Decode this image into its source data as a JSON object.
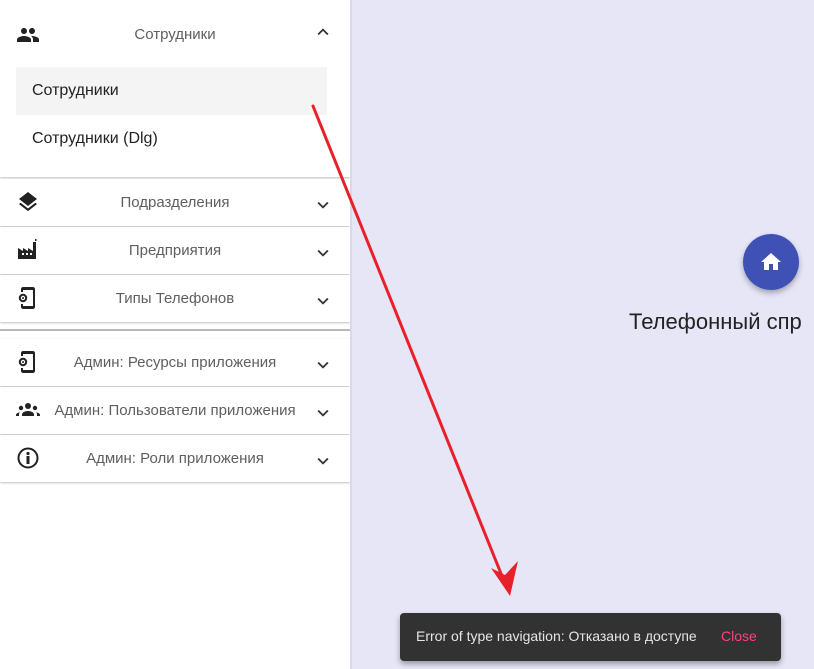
{
  "sidebar": {
    "groups": [
      {
        "label": "Сотрудники",
        "icon": "people-icon",
        "expanded": true,
        "items": [
          {
            "label": "Сотрудники",
            "active": true
          },
          {
            "label": "Сотрудники (Dlg)",
            "active": false
          }
        ]
      },
      {
        "label": "Подразделения",
        "icon": "layers-icon",
        "expanded": false
      },
      {
        "label": "Предприятия",
        "icon": "factory-icon",
        "expanded": false
      },
      {
        "label": "Типы Телефонов",
        "icon": "phone-settings-icon",
        "expanded": false
      },
      {
        "label": "Админ: Ресурсы приложения",
        "icon": "phone-settings-icon",
        "expanded": false
      },
      {
        "label": "Админ: Пользователи приложения",
        "icon": "group-icon",
        "expanded": false
      },
      {
        "label": "Админ: Роли приложения",
        "icon": "accessibility-icon",
        "expanded": false
      }
    ]
  },
  "main": {
    "home_icon": "home-icon",
    "title": "Телефонный спр"
  },
  "snackbar": {
    "message": "Error of type navigation: Отказано в доступе",
    "action": "Close"
  },
  "colors": {
    "accent": "#3f51b5",
    "snackbar_action": "#ff4081",
    "annotation_arrow": "#e8202a",
    "main_background": "#e6e6f7"
  }
}
